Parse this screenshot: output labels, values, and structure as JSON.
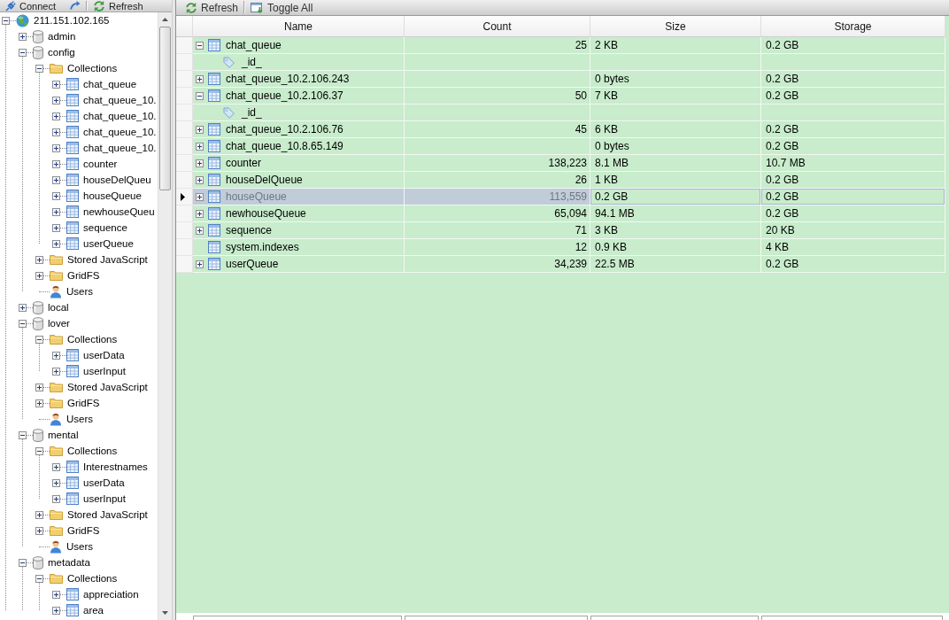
{
  "left_toolbar": {
    "buttons": [
      {
        "kind": "connect",
        "label": "Connect"
      },
      {
        "kind": "refresh",
        "label": "Refresh"
      }
    ]
  },
  "tree": {
    "label": "211.151.102.165",
    "kind": "server",
    "expanded": true,
    "children": [
      {
        "label": "admin",
        "kind": "database",
        "expanded": false
      },
      {
        "label": "config",
        "kind": "database",
        "expanded": true,
        "children": [
          {
            "label": "Collections",
            "kind": "folder",
            "expanded": true,
            "children": [
              {
                "label": "chat_queue",
                "kind": "collection",
                "expanded": false
              },
              {
                "label": "chat_queue_10.",
                "kind": "collection",
                "expanded": false
              },
              {
                "label": "chat_queue_10.",
                "kind": "collection",
                "expanded": false
              },
              {
                "label": "chat_queue_10.",
                "kind": "collection",
                "expanded": false
              },
              {
                "label": "chat_queue_10.",
                "kind": "collection",
                "expanded": false
              },
              {
                "label": "counter",
                "kind": "collection",
                "expanded": false
              },
              {
                "label": "houseDelQueu",
                "kind": "collection",
                "expanded": false
              },
              {
                "label": "houseQueue",
                "kind": "collection",
                "expanded": false
              },
              {
                "label": "newhouseQueu",
                "kind": "collection",
                "expanded": false
              },
              {
                "label": "sequence",
                "kind": "collection",
                "expanded": false
              },
              {
                "label": "userQueue",
                "kind": "collection",
                "expanded": false
              }
            ]
          },
          {
            "label": "Stored JavaScript",
            "kind": "folder",
            "expanded": false
          },
          {
            "label": "GridFS",
            "kind": "folder",
            "expanded": false
          },
          {
            "label": "Users",
            "kind": "users"
          }
        ]
      },
      {
        "label": "local",
        "kind": "database",
        "expanded": false
      },
      {
        "label": "lover",
        "kind": "database",
        "expanded": true,
        "children": [
          {
            "label": "Collections",
            "kind": "folder",
            "expanded": true,
            "children": [
              {
                "label": "userData",
                "kind": "collection",
                "expanded": false
              },
              {
                "label": "userInput",
                "kind": "collection",
                "expanded": false
              }
            ]
          },
          {
            "label": "Stored JavaScript",
            "kind": "folder",
            "expanded": false
          },
          {
            "label": "GridFS",
            "kind": "folder",
            "expanded": false
          },
          {
            "label": "Users",
            "kind": "users"
          }
        ]
      },
      {
        "label": "mental",
        "kind": "database",
        "expanded": true,
        "children": [
          {
            "label": "Collections",
            "kind": "folder",
            "expanded": true,
            "children": [
              {
                "label": "Interestnames",
                "kind": "collection",
                "expanded": false
              },
              {
                "label": "userData",
                "kind": "collection",
                "expanded": false
              },
              {
                "label": "userInput",
                "kind": "collection",
                "expanded": false
              }
            ]
          },
          {
            "label": "Stored JavaScript",
            "kind": "folder",
            "expanded": false
          },
          {
            "label": "GridFS",
            "kind": "folder",
            "expanded": false
          },
          {
            "label": "Users",
            "kind": "users"
          }
        ]
      },
      {
        "label": "metadata",
        "kind": "database",
        "expanded": true,
        "children": [
          {
            "label": "Collections",
            "kind": "folder",
            "expanded": true,
            "children": [
              {
                "label": "appreciation",
                "kind": "collection",
                "expanded": false
              },
              {
                "label": "area",
                "kind": "collection",
                "expanded": false
              }
            ]
          }
        ]
      }
    ]
  },
  "right_toolbar": {
    "buttons": [
      {
        "kind": "refresh",
        "label": "Refresh"
      },
      {
        "kind": "toggle",
        "label": "Toggle All"
      }
    ]
  },
  "grid": {
    "columns": [
      "Name",
      "Count",
      "Size",
      "Storage"
    ],
    "rows": [
      {
        "kind": "collection",
        "name": "chat_queue",
        "count": "25",
        "size": "2 KB",
        "storage": "0.2 GB",
        "expanded": true,
        "selected": false
      },
      {
        "kind": "index",
        "name": "_id_",
        "selected": false
      },
      {
        "kind": "collection",
        "name": "chat_queue_10.2.106.243",
        "size": "0 bytes",
        "storage": "0.2 GB",
        "expanded": false,
        "selected": false
      },
      {
        "kind": "collection",
        "name": "chat_queue_10.2.106.37",
        "count": "50",
        "size": "7 KB",
        "storage": "0.2 GB",
        "expanded": true,
        "selected": false
      },
      {
        "kind": "index",
        "name": "_id_",
        "selected": false
      },
      {
        "kind": "collection",
        "name": "chat_queue_10.2.106.76",
        "count": "45",
        "size": "6 KB",
        "storage": "0.2 GB",
        "expanded": false,
        "selected": false
      },
      {
        "kind": "collection",
        "name": "chat_queue_10.8.65.149",
        "size": "0 bytes",
        "storage": "0.2 GB",
        "expanded": false,
        "selected": false
      },
      {
        "kind": "collection",
        "name": "counter",
        "count": "138,223",
        "size": "8.1 MB",
        "storage": "10.7 MB",
        "expanded": false,
        "selected": false
      },
      {
        "kind": "collection",
        "name": "houseDelQueue",
        "count": "26",
        "size": "1 KB",
        "storage": "0.2 GB",
        "expanded": false,
        "selected": false
      },
      {
        "kind": "collection",
        "name": "houseQueue",
        "count": "113,559",
        "size": "0.2 GB",
        "storage": "0.2 GB",
        "expanded": false,
        "selected": true
      },
      {
        "kind": "collection",
        "name": "newhouseQueue",
        "count": "65,094",
        "size": "94.1 MB",
        "storage": "0.2 GB",
        "expanded": false,
        "selected": false
      },
      {
        "kind": "collection",
        "name": "sequence",
        "count": "71",
        "size": "3 KB",
        "storage": "20 KB",
        "expanded": false,
        "selected": false
      },
      {
        "kind": "collection",
        "name": "system.indexes",
        "count": "12",
        "size": "0.9 KB",
        "storage": "4 KB",
        "selected": false
      },
      {
        "kind": "collection",
        "name": "userQueue",
        "count": "34,239",
        "size": "22.5 MB",
        "storage": "0.2 GB",
        "expanded": false,
        "selected": false
      }
    ]
  }
}
